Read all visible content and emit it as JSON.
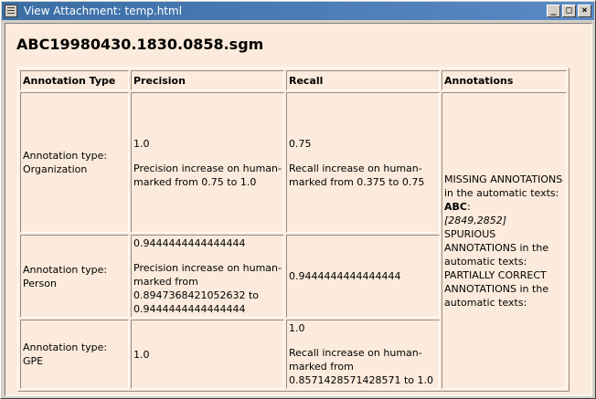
{
  "window": {
    "title": "View Attachment: temp.html",
    "menu_icon": "window-menu-icon",
    "buttons": [
      {
        "name": "minimize",
        "glyph": "_"
      },
      {
        "name": "maximize",
        "glyph": "□"
      },
      {
        "name": "close",
        "glyph": "×"
      }
    ]
  },
  "doc": {
    "heading": "ABC19980430.1830.0858.sgm",
    "headers": {
      "type": "Annotation Type",
      "precision": "Precision",
      "recall": "Recall",
      "annotations": "Annotations"
    },
    "rows": [
      {
        "type": "Annotation type: Organization",
        "precision": "1.0",
        "precision_note": "Precision increase on human-marked from 0.75 to 1.0",
        "recall": "0.75",
        "recall_note": "Recall increase on human-marked from 0.375 to 0.75"
      },
      {
        "type": "Annotation type: Person",
        "precision": "0.9444444444444444",
        "precision_note": "Precision increase on human-marked from 0.8947368421052632 to 0.9444444444444444",
        "recall": "0.9444444444444444",
        "recall_note": ""
      },
      {
        "type": "Annotation type: GPE",
        "precision": "1.0",
        "precision_note": "",
        "recall": "1.0",
        "recall_note": "Recall increase on human-marked from 0.8571428571428571 to 1.0"
      }
    ],
    "annotations": {
      "missing_label": "MISSING ANNOTATIONS in the automatic texts:",
      "missing_entity": "ABC",
      "missing_colon": ":",
      "missing_span": "[2849,2852]",
      "spurious_label": "SPURIOUS ANNOTATIONS in the automatic texts:",
      "partial_label": "PARTIALLY CORRECT ANNOTATIONS in the automatic texts:"
    }
  },
  "colors": {
    "content_bg": "#fcebdc",
    "titlebar": "#3a6ea5",
    "chrome": "#d4d0c8"
  }
}
